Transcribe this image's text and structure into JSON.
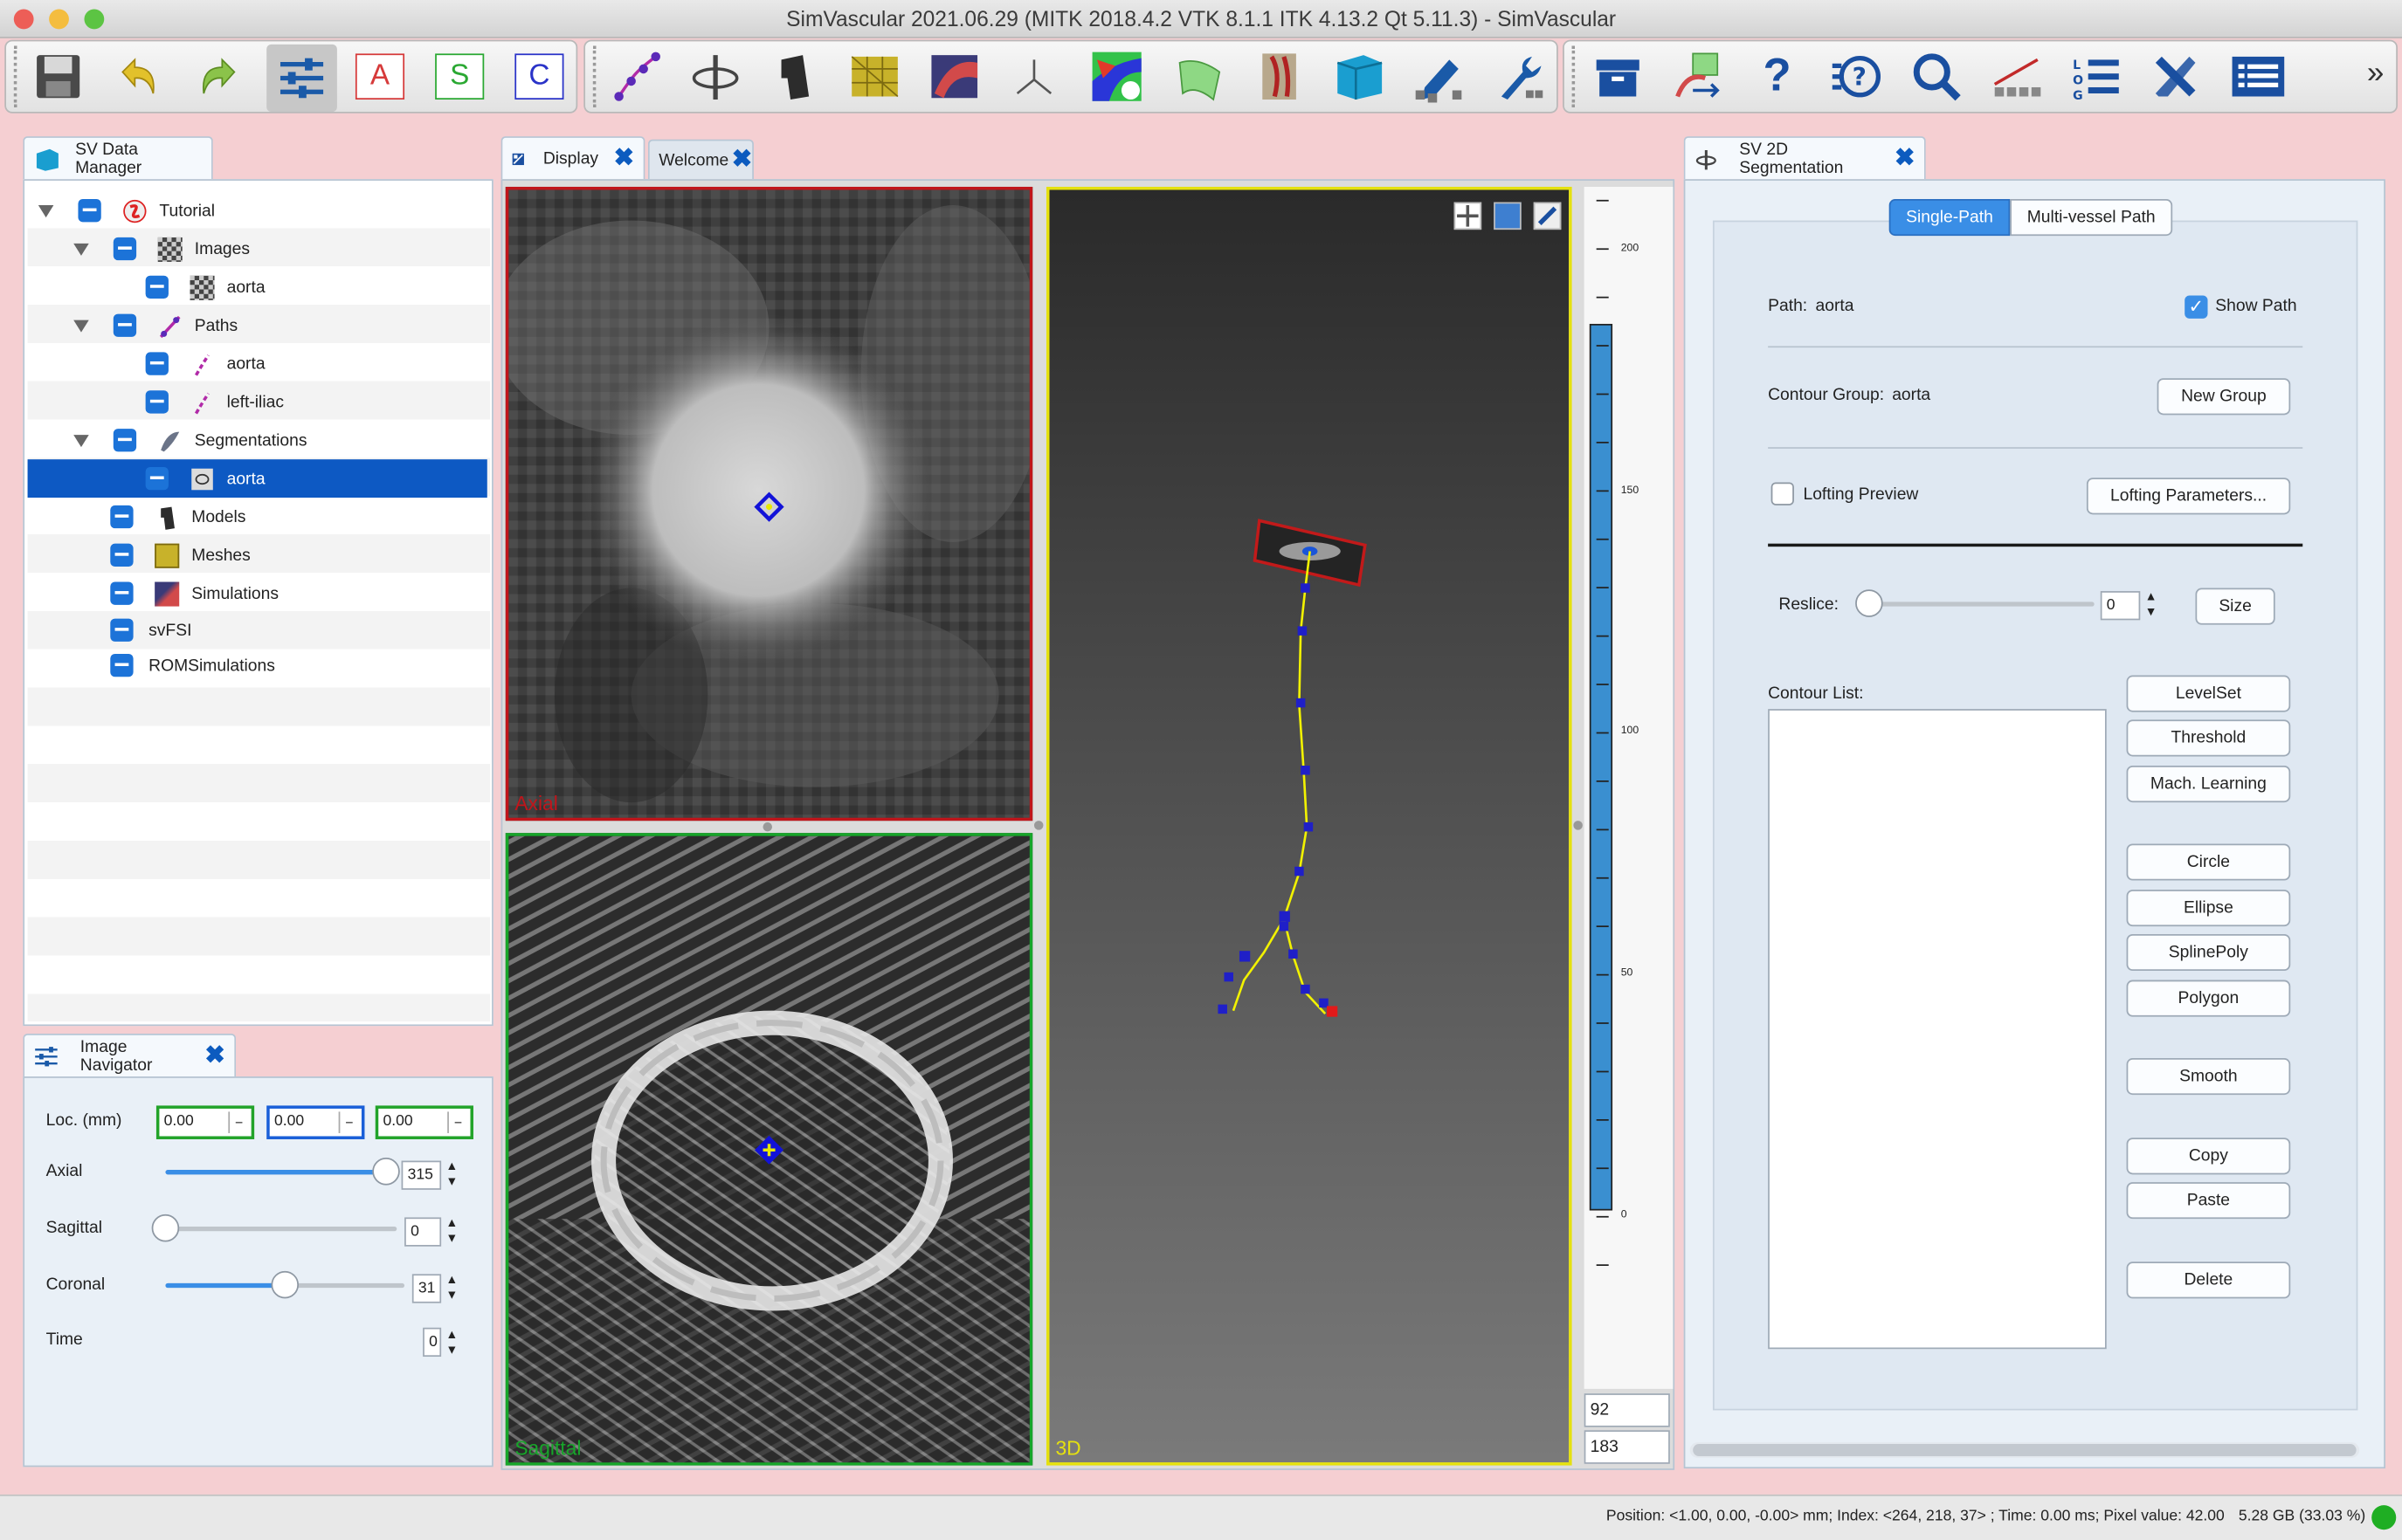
{
  "window": {
    "title": "SimVascular 2021.06.29 (MITK 2018.4.2 VTK 8.1.1 ITK 4.13.2 Qt 5.11.3) - SimVascular"
  },
  "toolbar": {
    "icons": [
      "save-icon",
      "undo-icon",
      "redo-icon",
      "image-navigator-icon",
      "segmentation-a-icon",
      "segmentation-s-icon",
      "segmentation-c-icon",
      "path-icon",
      "path-planning-icon",
      "model-icon",
      "mesh-icon",
      "simulation-icon",
      "axes-icon",
      "model-color-icon",
      "surface-icon",
      "segmentation-icon",
      "database-icon",
      "edit-icon",
      "tools-icon",
      "archive-icon",
      "transform-icon",
      "help-icon",
      "faq-icon",
      "search-icon",
      "measure-icon",
      "log-icon",
      "settings-icon",
      "list-icon",
      "more-icon"
    ],
    "buttons": {
      "a": "A",
      "s": "S",
      "c": "C",
      "more": "»"
    }
  },
  "data_manager": {
    "tab_label": "SV Data Manager",
    "tree": [
      {
        "label": "Tutorial",
        "depth": 0,
        "icon": "project-icon",
        "expanded": true
      },
      {
        "label": "Images",
        "depth": 1,
        "icon": "images-icon",
        "expanded": true
      },
      {
        "label": "aorta",
        "depth": 2,
        "icon": "image-icon"
      },
      {
        "label": "Paths",
        "depth": 1,
        "icon": "paths-icon",
        "expanded": true
      },
      {
        "label": "aorta",
        "depth": 2,
        "icon": "path-icon"
      },
      {
        "label": "left-iliac",
        "depth": 2,
        "icon": "path-icon"
      },
      {
        "label": "Segmentations",
        "depth": 1,
        "icon": "segmentations-icon",
        "expanded": true
      },
      {
        "label": "aorta",
        "depth": 2,
        "icon": "segmentation-icon",
        "selected": true
      },
      {
        "label": "Models",
        "depth": 1,
        "icon": "models-icon"
      },
      {
        "label": "Meshes",
        "depth": 1,
        "icon": "meshes-icon"
      },
      {
        "label": "Simulations",
        "depth": 1,
        "icon": "simulations-icon"
      },
      {
        "label": "svFSI",
        "depth": 1
      },
      {
        "label": "ROMSimulations",
        "depth": 1
      }
    ]
  },
  "image_navigator": {
    "tab_label": "Image Navigator",
    "loc_label": "Loc. (mm)",
    "loc_values": [
      "0.00",
      "0.00",
      "0.00"
    ],
    "sliders": [
      {
        "label": "Axial",
        "value": "315",
        "fraction": 1.0
      },
      {
        "label": "Sagittal",
        "value": "0",
        "fraction": 0.0
      },
      {
        "label": "Coronal",
        "value": "31",
        "fraction": 0.5
      },
      {
        "label": "Time",
        "value": "0"
      }
    ]
  },
  "display": {
    "tabs": [
      {
        "label": "Display"
      },
      {
        "label": "Welcome"
      }
    ],
    "views": {
      "axial": "Axial",
      "sagittal": "Sagittal",
      "threed": "3D"
    },
    "scale_ticks": [
      "200",
      "150",
      "100",
      "50",
      "0"
    ],
    "scale_fraction": 1.0,
    "level_values": [
      "92",
      "183"
    ]
  },
  "segmentation": {
    "tab_label": "SV 2D Segmentation",
    "mode_tabs": [
      "Single-Path",
      "Multi-vessel Path"
    ],
    "path_label": "Path:",
    "path_value": "aorta",
    "show_path_label": "Show Path",
    "show_path_checked": true,
    "contour_group_label": "Contour Group:",
    "contour_group_value": "aorta",
    "new_group_button": "New Group",
    "lofting_preview_label": "Lofting Preview",
    "lofting_parameters_button": "Lofting Parameters...",
    "reslice_label": "Reslice:",
    "reslice_value": "0",
    "size_button": "Size",
    "contour_list_label": "Contour List:",
    "method_buttons": [
      "LevelSet",
      "Threshold",
      "Mach. Learning"
    ],
    "shape_buttons": [
      "Circle",
      "Ellipse",
      "SplinePoly",
      "Polygon"
    ],
    "smooth_button": "Smooth",
    "edit_buttons": [
      "Copy",
      "Paste"
    ],
    "delete_button": "Delete"
  },
  "status_bar": {
    "text": "Position: <1.00, 0.00, -0.00> mm; Index: <264, 218, 37> ; Time: 0.00 ms; Pixel value: 42.00",
    "memory": "5.28 GB (33.03 %)"
  },
  "colors": {
    "accent": "#0d59c3",
    "axial_border": "#c0151b",
    "sagittal_border": "#17a62a",
    "threed_border": "#e5e10f",
    "path_line": "#f2f200",
    "path_point": "#1f1fc8",
    "scale_blue": "#3a8fd0"
  }
}
